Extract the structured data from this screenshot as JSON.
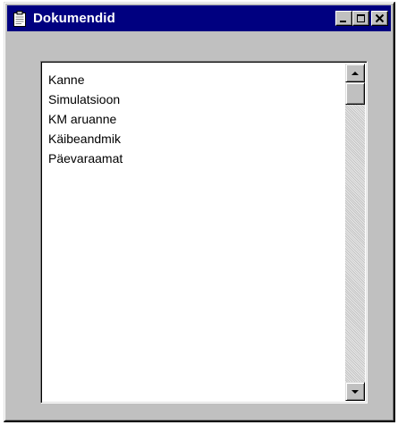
{
  "window": {
    "title": "Dokumendid",
    "icon": "document-icon",
    "controls": [
      "minimize",
      "maximize",
      "close"
    ]
  },
  "list": {
    "items": [
      "Kanne",
      "Simulatsioon",
      "KM aruanne",
      "Käibeandmik",
      "Päevaraamat"
    ]
  },
  "colors": {
    "titlebar": "#000080",
    "face": "#c0c0c0",
    "list_bg": "#ffffff"
  }
}
